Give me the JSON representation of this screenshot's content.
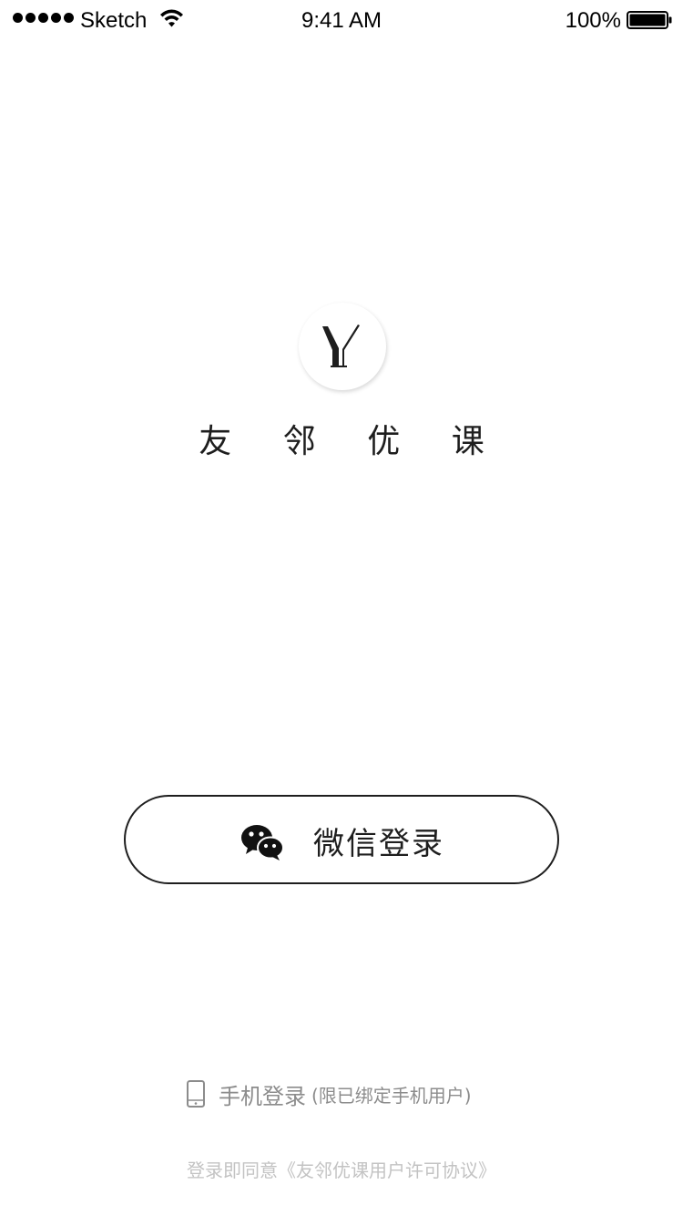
{
  "status_bar": {
    "carrier": "Sketch",
    "time": "9:41 AM",
    "battery": "100%"
  },
  "brand": {
    "logo_letter": "Y",
    "name_chars": [
      "友",
      "邻",
      "优",
      "课"
    ]
  },
  "wechat_login": {
    "label": "微信登录",
    "icon": "wechat-icon"
  },
  "phone_login": {
    "label": "手机登录",
    "note": "(限已绑定手机用户)",
    "icon": "mobile-phone-icon"
  },
  "agreement": {
    "prefix": "登录即同意",
    "link": "《友邻优课用户许可协议》"
  },
  "colors": {
    "text": "#1e1e1e",
    "secondary": "#8c8c8c",
    "muted": "#c3c3c3",
    "background": "#ffffff"
  }
}
